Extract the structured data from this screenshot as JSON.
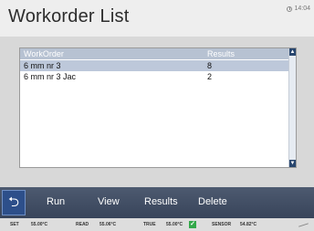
{
  "header": {
    "title": "Workorder List",
    "time": "14:04"
  },
  "list": {
    "columns": [
      "WorkOrder",
      "Results"
    ],
    "rows": [
      {
        "workorder": "6 mm nr 3",
        "results": "8",
        "selected": true
      },
      {
        "workorder": "6 mm nr 3 Jac",
        "results": "2",
        "selected": false
      }
    ]
  },
  "toolbar": {
    "back_icon": "back-arrow-icon",
    "run_label": "Run",
    "view_label": "View",
    "results_label": "Results",
    "delete_label": "Delete"
  },
  "status": {
    "set_label": "SET",
    "set_value": "55.00°C",
    "read_label": "READ",
    "read_value": "55.06°C",
    "true_label": "TRUE",
    "true_value": "55.00°C",
    "sensor_label": "SENSOR",
    "sensor_value": "54.82°C"
  },
  "colors": {
    "header_bg": "#eeeeee",
    "content_bg": "#d8d8d8",
    "list_header_bg": "#b7c2d2",
    "selected_row_bg": "#bdc8da",
    "toolbar_bg": "#45516a",
    "back_button_bg": "#2d4f8a",
    "status_ok": "#33a84a"
  }
}
